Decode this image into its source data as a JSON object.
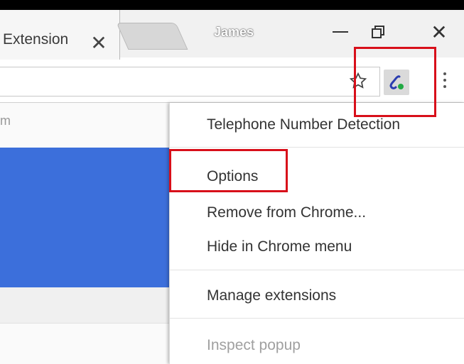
{
  "browser": {
    "active_tab": {
      "title": "Extension"
    },
    "profile_name": "James",
    "colors": {
      "accent_red": "#d80f1a",
      "selection_blue": "#3c6fdb"
    }
  },
  "page": {
    "row_label_fragment": "m"
  },
  "extension_menu": {
    "title": "Telephone Number Detection",
    "items": [
      {
        "label": "Options"
      },
      {
        "label": "Remove from Chrome..."
      },
      {
        "label": "Hide in Chrome menu"
      },
      {
        "label": "Manage extensions"
      },
      {
        "label": "Inspect popup"
      }
    ]
  },
  "icons": {
    "tab_close": "close-icon",
    "minimize": "minimize-icon",
    "maximize": "restore-icon",
    "window_close": "close-icon",
    "bookmark": "star-icon",
    "extension": "phone-extension-icon",
    "menu": "kebab-menu-icon"
  }
}
